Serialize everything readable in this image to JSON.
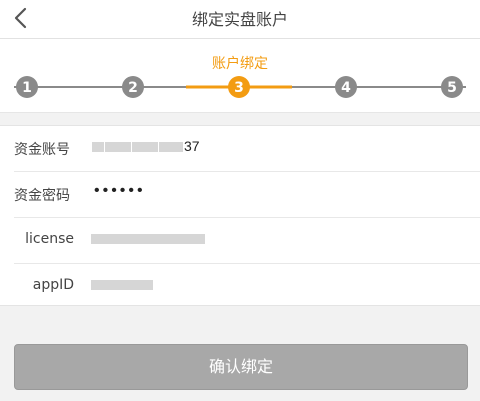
{
  "header": {
    "title": "绑定实盘账户"
  },
  "steps": {
    "caption": "账户绑定",
    "items": [
      "1",
      "2",
      "3",
      "4",
      "5"
    ],
    "current": 3,
    "accent_color": "#f39c12",
    "inactive_color": "#8a8a8a"
  },
  "form": {
    "account_label": "资金账号",
    "account_value_visible": "37",
    "password_label": "资金密码",
    "password_value": "••••••",
    "license_label": "license",
    "appid_label": "appID"
  },
  "confirm_button": {
    "label": "确认绑定"
  }
}
